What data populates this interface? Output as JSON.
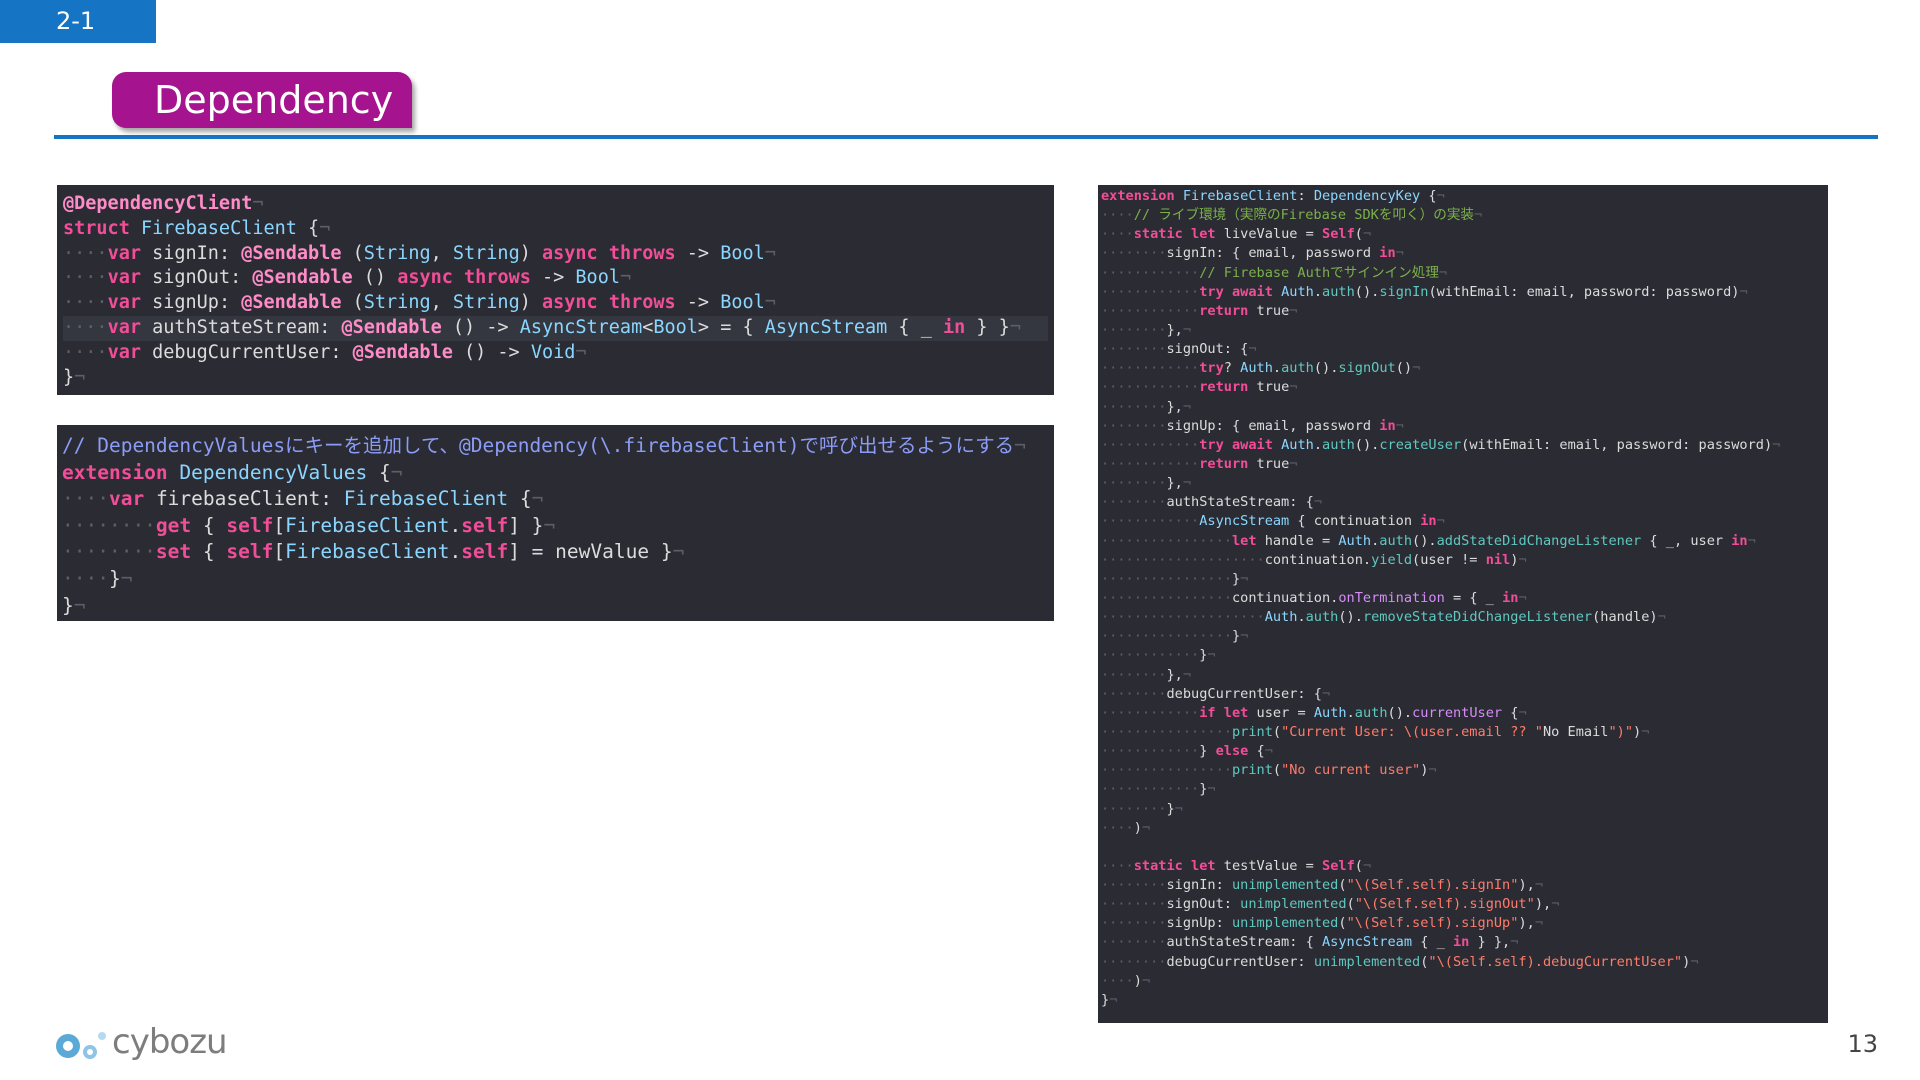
{
  "slide": {
    "section": "2-1",
    "title": "Dependency",
    "page_number": "13",
    "brand": "cybozu"
  },
  "colors": {
    "accent_blue": "#1575c4",
    "title_magenta": "#a6138e",
    "code_bg": "#2b2c33"
  },
  "code_blocks": [
    {
      "name": "firebase-client-struct",
      "lines": [
        "@DependencyClient¬",
        "struct FirebaseClient {¬",
        "····var signIn: @Sendable (String, String) async throws -> Bool¬",
        "····var signOut: @Sendable () async throws -> Bool¬",
        "····var signUp: @Sendable (String, String) async throws -> Bool¬",
        "····var authStateStream: @Sendable () -> AsyncStream<Bool> = { AsyncStream { _ in } }¬",
        "····var debugCurrentUser: @Sendable () -> Void¬",
        "}¬"
      ]
    },
    {
      "name": "dependency-values-extension",
      "lines": [
        "// DependencyValuesにキーを追加して、@Dependency(\\.firebaseClient)で呼び出せるようにする¬",
        "extension DependencyValues {¬",
        "····var firebaseClient: FirebaseClient {¬",
        "········get { self[FirebaseClient.self] }¬",
        "········set { self[FirebaseClient.self] = newValue }¬",
        "····}¬",
        "}¬"
      ]
    },
    {
      "name": "dependency-key-extension",
      "lines": [
        "extension FirebaseClient: DependencyKey {¬",
        "····// ライブ環境（実際のFirebase SDKを叩く）の実装¬",
        "····static let liveValue = Self(¬",
        "········signIn: { email, password in¬",
        "············// Firebase Authでサインイン処理¬",
        "············try await Auth.auth().signIn(withEmail: email, password: password)¬",
        "············return true¬",
        "········},¬",
        "········signOut: {¬",
        "············try? Auth.auth().signOut()¬",
        "············return true¬",
        "········},¬",
        "········signUp: { email, password in¬",
        "············try await Auth.auth().createUser(withEmail: email, password: password)¬",
        "············return true¬",
        "········},¬",
        "········authStateStream: {¬",
        "············AsyncStream { continuation in¬",
        "················let handle = Auth.auth().addStateDidChangeListener { _, user in¬",
        "····················continuation.yield(user != nil)¬",
        "················}¬",
        "················continuation.onTermination = { _ in¬",
        "····················Auth.auth().removeStateDidChangeListener(handle)¬",
        "················}¬",
        "············}¬",
        "········},¬",
        "········debugCurrentUser: {¬",
        "············if let user = Auth.auth().currentUser {¬",
        "················print(\"Current User: \\(user.email ?? \"No Email\")\")¬",
        "············} else {¬",
        "················print(\"No current user\")¬",
        "············}¬",
        "········}¬",
        "····)¬",
        "",
        "····static let testValue = Self(¬",
        "········signIn: unimplemented(\"\\(Self.self).signIn\"),¬",
        "········signOut: unimplemented(\"\\(Self.self).signOut\"),¬",
        "········signUp: unimplemented(\"\\(Self.self).signUp\"),¬",
        "········authStateStream: { AsyncStream { _ in } },¬",
        "········debugCurrentUser: unimplemented(\"\\(Self.self).debugCurrentUser\")¬",
        "····)¬",
        "}¬"
      ]
    }
  ]
}
